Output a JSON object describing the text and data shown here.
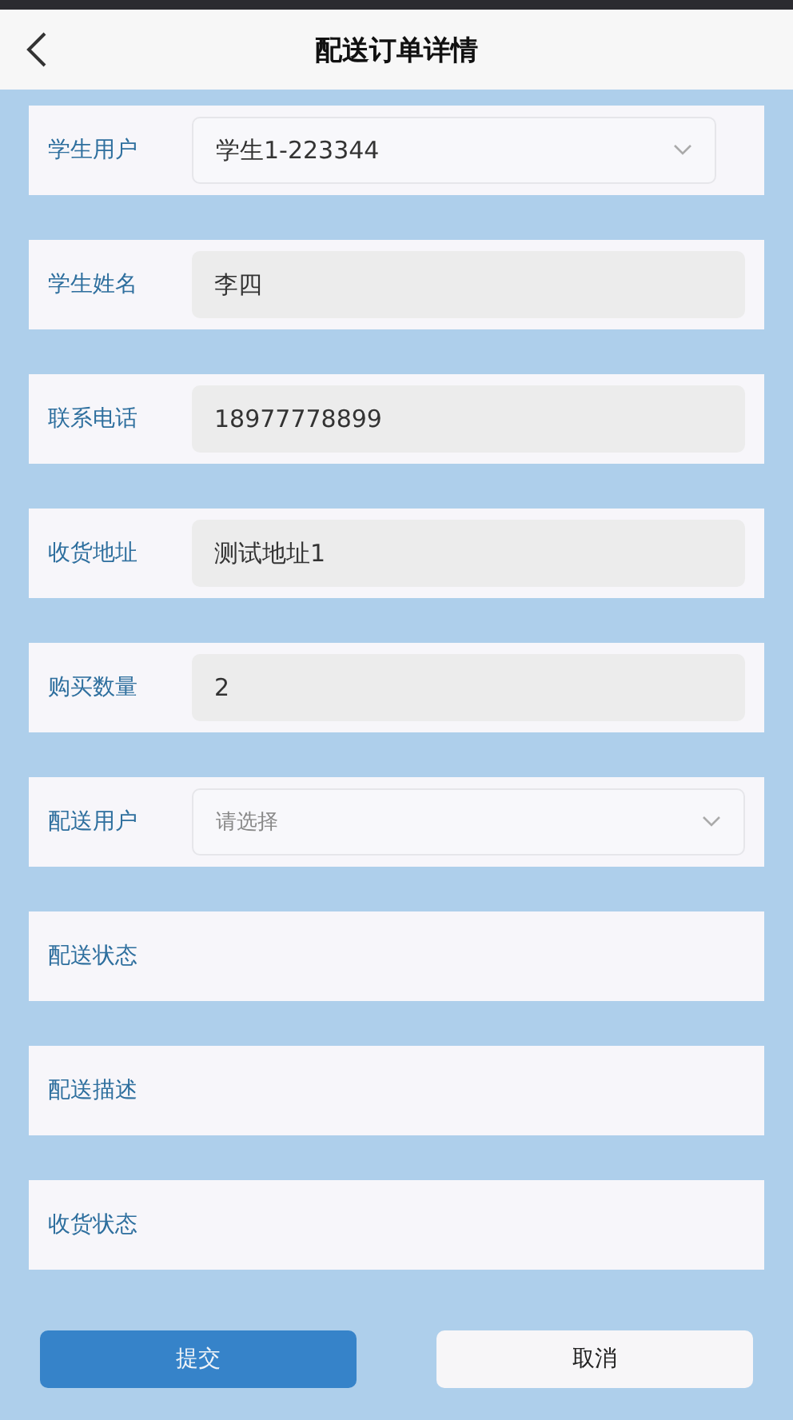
{
  "header": {
    "title": "配送订单详情"
  },
  "fields": [
    {
      "kind": "select",
      "label": "学生用户",
      "value": "学生1-223344"
    },
    {
      "kind": "readonly",
      "label": "学生姓名",
      "value": "李四"
    },
    {
      "kind": "readonly",
      "label": "联系电话",
      "value": "18977778899"
    },
    {
      "kind": "readonly",
      "label": "收货地址",
      "value": "测试地址1"
    },
    {
      "kind": "readonly",
      "label": "购买数量",
      "value": "2"
    },
    {
      "kind": "select",
      "label": "配送用户",
      "placeholder": "请选择"
    },
    {
      "kind": "empty",
      "label": "配送状态"
    },
    {
      "kind": "empty",
      "label": "配送描述"
    },
    {
      "kind": "empty",
      "label": "收货状态"
    }
  ],
  "buttons": [
    {
      "kind": "primary",
      "label": "提交"
    },
    {
      "kind": "secondary",
      "label": "取消"
    }
  ]
}
